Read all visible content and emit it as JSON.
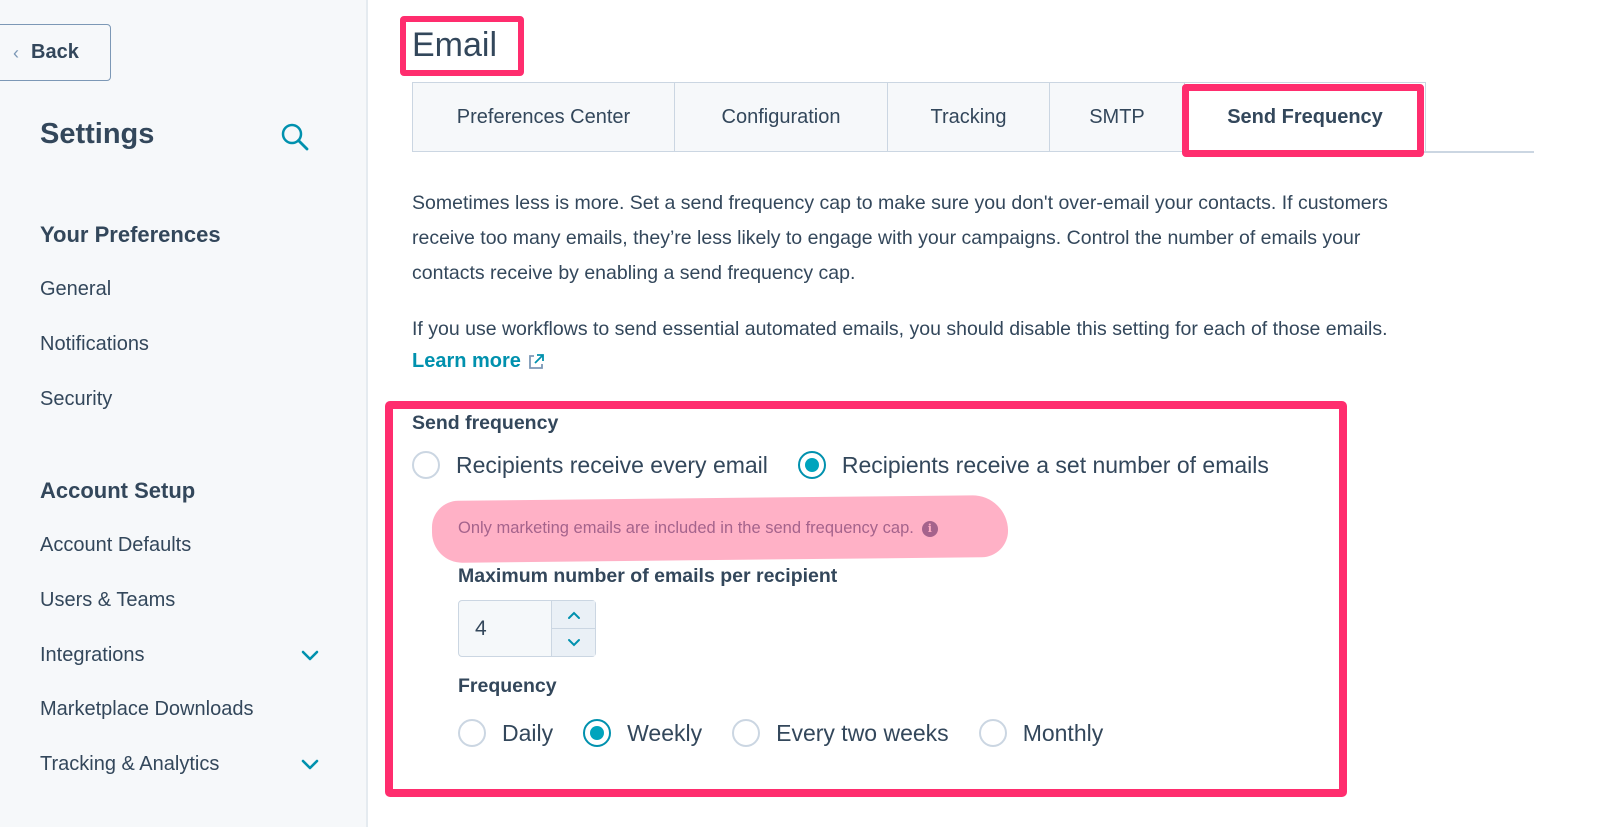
{
  "sidebar": {
    "back_label": "Back",
    "title": "Settings",
    "sections": [
      {
        "heading": "Your Preferences",
        "items": [
          {
            "label": "General"
          },
          {
            "label": "Notifications"
          },
          {
            "label": "Security"
          }
        ]
      },
      {
        "heading": "Account Setup",
        "items": [
          {
            "label": "Account Defaults"
          },
          {
            "label": "Users & Teams"
          },
          {
            "label": "Integrations",
            "expandable": true
          },
          {
            "label": "Marketplace Downloads"
          },
          {
            "label": "Tracking & Analytics",
            "expandable": true
          }
        ]
      }
    ]
  },
  "page": {
    "title": "Email",
    "tabs": [
      {
        "label": "Preferences Center",
        "active": false
      },
      {
        "label": "Configuration",
        "active": false
      },
      {
        "label": "Tracking",
        "active": false
      },
      {
        "label": "SMTP",
        "active": false
      },
      {
        "label": "Send Frequency",
        "active": true
      }
    ],
    "intro_lines": [
      "Sometimes less is more. Set a send frequency cap to make sure you don't over-email your contacts. If customers",
      "receive too many emails, they’re less likely to engage with your campaigns. Control the number of emails your",
      "contacts receive by enabling a send frequency cap."
    ],
    "workflow_note": "If you use workflows to send essential automated emails, you should disable this setting for each of those emails.",
    "learn_more": "Learn more"
  },
  "send_frequency": {
    "label": "Send frequency",
    "options": [
      {
        "label": "Recipients receive every email",
        "checked": false
      },
      {
        "label": "Recipients receive a set number of emails",
        "checked": true
      }
    ],
    "note": "Only marketing emails are included in the send frequency cap.",
    "max_label": "Maximum number of emails per recipient",
    "max_value": "4",
    "frequency_label": "Frequency",
    "frequency_options": [
      {
        "label": "Daily",
        "checked": false
      },
      {
        "label": "Weekly",
        "checked": true
      },
      {
        "label": "Every two weeks",
        "checked": false
      },
      {
        "label": "Monthly",
        "checked": false
      }
    ]
  },
  "colors": {
    "accent": "#00a4bd",
    "link": "#0091ae",
    "annotation": "#ff2d6e",
    "highlight": "#ffadc3",
    "text": "#33475b"
  }
}
